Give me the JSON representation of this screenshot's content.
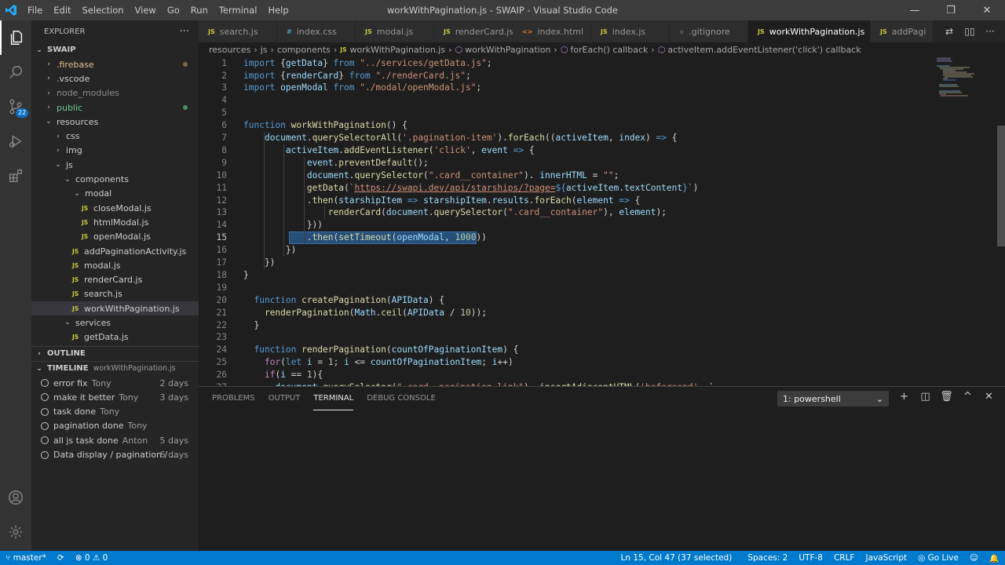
{
  "window": {
    "title": "workWithPagination.js - SWAIP - Visual Studio Code",
    "menu": [
      "File",
      "Edit",
      "Selection",
      "View",
      "Go",
      "Run",
      "Terminal",
      "Help"
    ]
  },
  "activity_bar": {
    "scm_badge": "22"
  },
  "explorer": {
    "header": "EXPLORER",
    "more": "···",
    "root": "SWAIP",
    "tree": [
      {
        "label": ".firebase",
        "chev": "›",
        "color": "#e2c08d",
        "dot": "#806a44"
      },
      {
        "label": ".vscode",
        "chev": "›",
        "color": "#cccccc"
      },
      {
        "label": "node_modules",
        "chev": "›",
        "color": "#8c8c8c"
      },
      {
        "label": "public",
        "chev": "›",
        "color": "#73c991",
        "dot": "#4b8e5e"
      },
      {
        "label": "resources",
        "chev": "⌄",
        "color": "#cccccc"
      },
      {
        "label": "css",
        "chev": "›",
        "color": "#cccccc"
      },
      {
        "label": "img",
        "chev": "›",
        "color": "#cccccc"
      },
      {
        "label": "js",
        "chev": "⌄",
        "color": "#cccccc"
      },
      {
        "label": "components",
        "chev": "⌄",
        "color": "#cccccc"
      },
      {
        "label": "modal",
        "chev": "⌄",
        "color": "#cccccc"
      },
      {
        "label": "closeModal.js",
        "js": "JS",
        "color": "#cccccc"
      },
      {
        "label": "htmlModal.js",
        "js": "JS",
        "color": "#cccccc"
      },
      {
        "label": "openModal.js",
        "js": "JS",
        "color": "#cccccc"
      },
      {
        "label": "addPaginationActivity.js",
        "js": "JS",
        "color": "#cccccc"
      },
      {
        "label": "modal.js",
        "js": "JS",
        "color": "#cccccc"
      },
      {
        "label": "renderCard.js",
        "js": "JS",
        "color": "#cccccc"
      },
      {
        "label": "search.js",
        "js": "JS",
        "color": "#cccccc"
      },
      {
        "label": "workWithPagination.js",
        "js": "JS",
        "color": "#cccccc",
        "selected": true
      },
      {
        "label": "services",
        "chev": "⌄",
        "color": "#cccccc"
      },
      {
        "label": "getData.js",
        "js": "JS",
        "color": "#cccccc"
      }
    ],
    "outline": "OUTLINE",
    "timeline": "TIMELINE",
    "timeline_file": "workWithPagination.js",
    "timeline_items": [
      {
        "msg": "error fix",
        "author": "Tony",
        "when": "2 days"
      },
      {
        "msg": "make it better",
        "author": "Tony",
        "when": "3 days"
      },
      {
        "msg": "task done",
        "author": "Tony",
        "when": ""
      },
      {
        "msg": "pagination done",
        "author": "Tony",
        "when": ""
      },
      {
        "msg": "all js task done",
        "author": "Anton",
        "when": "5 days"
      },
      {
        "msg": "Data display / pagination / ...",
        "author": "",
        "when": "6 days"
      }
    ]
  },
  "tabs": [
    {
      "label": "search.js",
      "icon": "JS",
      "icolor": "#cbcb41"
    },
    {
      "label": "index.css",
      "icon": "#",
      "icolor": "#519aba"
    },
    {
      "label": "modal.js",
      "icon": "JS",
      "icolor": "#cbcb41"
    },
    {
      "label": "renderCard.js",
      "icon": "JS",
      "icolor": "#cbcb41"
    },
    {
      "label": "index.html",
      "icon": "<>",
      "icolor": "#e37933"
    },
    {
      "label": "index.js",
      "icon": "JS",
      "icolor": "#cbcb41"
    },
    {
      "label": ".gitignore",
      "icon": "◆",
      "icolor": "#41535b"
    },
    {
      "label": "workWithPagination.js",
      "icon": "JS",
      "icolor": "#cbcb41",
      "active": true
    },
    {
      "label": "addPagi",
      "icon": "JS",
      "icolor": "#cbcb41"
    }
  ],
  "breadcrumb": [
    "resources",
    "js",
    "components",
    "workWithPagination.js",
    "workWithPagination",
    "forEach() callback",
    "activeItem.addEventListener('click') callback"
  ],
  "code": [
    [
      [
        "kw",
        "import "
      ],
      [
        "pl",
        "{"
      ],
      [
        "var",
        "getData"
      ],
      [
        "pl",
        "} "
      ],
      [
        "kw",
        "from "
      ],
      [
        "str",
        "\"../services/getData.js\""
      ],
      [
        "pl",
        ";"
      ]
    ],
    [
      [
        "kw",
        "import "
      ],
      [
        "pl",
        "{"
      ],
      [
        "var",
        "renderCard"
      ],
      [
        "pl",
        "} "
      ],
      [
        "kw",
        "from "
      ],
      [
        "str",
        "\"./renderCard.js\""
      ],
      [
        "pl",
        ";"
      ]
    ],
    [
      [
        "kw",
        "import "
      ],
      [
        "var",
        "openModal "
      ],
      [
        "kw",
        "from "
      ],
      [
        "str",
        "\"./modal/openModal.js\""
      ],
      [
        "pl",
        ";"
      ]
    ],
    [],
    [],
    [
      [
        "kw",
        "function "
      ],
      [
        "fn",
        "workWithPagination"
      ],
      [
        "pl",
        "() {"
      ]
    ],
    [
      [
        "pl",
        "    "
      ],
      [
        "var",
        "document"
      ],
      [
        "pl",
        "."
      ],
      [
        "fn",
        "querySelectorAll"
      ],
      [
        "pl",
        "("
      ],
      [
        "str",
        "'.pagination-item'"
      ],
      [
        "pl",
        ")."
      ],
      [
        "fn",
        "forEach"
      ],
      [
        "pl",
        "(("
      ],
      [
        "var",
        "activeItem"
      ],
      [
        "pl",
        ", "
      ],
      [
        "var",
        "index"
      ],
      [
        "pl",
        ") "
      ],
      [
        "kw",
        "=>"
      ],
      [
        "pl",
        " {"
      ]
    ],
    [
      [
        "pl",
        "        "
      ],
      [
        "var",
        "activeItem"
      ],
      [
        "pl",
        "."
      ],
      [
        "fn",
        "addEventListener"
      ],
      [
        "pl",
        "("
      ],
      [
        "str",
        "'click'"
      ],
      [
        "pl",
        ", "
      ],
      [
        "var",
        "event "
      ],
      [
        "kw",
        "=>"
      ],
      [
        "pl",
        " {"
      ]
    ],
    [
      [
        "pl",
        "            "
      ],
      [
        "var",
        "event"
      ],
      [
        "pl",
        "."
      ],
      [
        "fn",
        "preventDefault"
      ],
      [
        "pl",
        "();"
      ]
    ],
    [
      [
        "pl",
        "            "
      ],
      [
        "var",
        "document"
      ],
      [
        "pl",
        "."
      ],
      [
        "fn",
        "querySelector"
      ],
      [
        "pl",
        "("
      ],
      [
        "str",
        "\".card__container\""
      ],
      [
        "pl",
        "). "
      ],
      [
        "var",
        "innerHTML"
      ],
      [
        "pl",
        " = "
      ],
      [
        "str",
        "\"\""
      ],
      [
        "pl",
        ";"
      ]
    ],
    [
      [
        "pl",
        "            "
      ],
      [
        "fn",
        "getData"
      ],
      [
        "pl",
        "("
      ],
      [
        "str",
        "`"
      ],
      [
        "url",
        "https://swapi.dev/api/starships/?page="
      ],
      [
        "tpl",
        "${"
      ],
      [
        "var",
        "activeItem"
      ],
      [
        "pl",
        "."
      ],
      [
        "var",
        "textContent"
      ],
      [
        "tpl",
        "}"
      ],
      [
        "str",
        "`"
      ],
      [
        "pl",
        ")"
      ]
    ],
    [
      [
        "pl",
        "            ."
      ],
      [
        "fn",
        "then"
      ],
      [
        "pl",
        "("
      ],
      [
        "var",
        "starshipItem "
      ],
      [
        "kw",
        "=>"
      ],
      [
        "pl",
        " "
      ],
      [
        "var",
        "starshipItem"
      ],
      [
        "pl",
        "."
      ],
      [
        "var",
        "results"
      ],
      [
        "pl",
        "."
      ],
      [
        "fn",
        "forEach"
      ],
      [
        "pl",
        "("
      ],
      [
        "var",
        "element "
      ],
      [
        "kw",
        "=>"
      ],
      [
        "pl",
        " {"
      ]
    ],
    [
      [
        "pl",
        "                "
      ],
      [
        "fn",
        "renderCard"
      ],
      [
        "pl",
        "("
      ],
      [
        "var",
        "document"
      ],
      [
        "pl",
        "."
      ],
      [
        "fn",
        "querySelector"
      ],
      [
        "pl",
        "("
      ],
      [
        "str",
        "\".card__container\""
      ],
      [
        "pl",
        "), "
      ],
      [
        "var",
        "element"
      ],
      [
        "pl",
        ");"
      ]
    ],
    [
      [
        "pl",
        "            }))"
      ]
    ],
    [
      [
        "pl",
        "            ."
      ],
      [
        "fn",
        "then"
      ],
      [
        "pl",
        "("
      ],
      [
        "fn",
        "setTimeout"
      ],
      [
        "pl",
        "("
      ],
      [
        "var",
        "openModal"
      ],
      [
        "pl",
        ", "
      ],
      [
        "num",
        "1000"
      ],
      [
        "pl",
        "))"
      ]
    ],
    [
      [
        "pl",
        "        })"
      ]
    ],
    [
      [
        "pl",
        "    })"
      ]
    ],
    [
      [
        "pl",
        "}"
      ]
    ],
    [],
    [
      [
        "pl",
        "  "
      ],
      [
        "kw",
        "function "
      ],
      [
        "fn",
        "createPagination"
      ],
      [
        "pl",
        "("
      ],
      [
        "var",
        "APIData"
      ],
      [
        "pl",
        ") {"
      ]
    ],
    [
      [
        "pl",
        "    "
      ],
      [
        "fn",
        "renderPagination"
      ],
      [
        "pl",
        "("
      ],
      [
        "var",
        "Math"
      ],
      [
        "pl",
        "."
      ],
      [
        "fn",
        "ceil"
      ],
      [
        "pl",
        "("
      ],
      [
        "var",
        "APIData"
      ],
      [
        "pl",
        " / "
      ],
      [
        "num",
        "10"
      ],
      [
        "pl",
        "));"
      ]
    ],
    [
      [
        "pl",
        "  }"
      ]
    ],
    [],
    [
      [
        "pl",
        "  "
      ],
      [
        "kw",
        "function "
      ],
      [
        "fn",
        "renderPagination"
      ],
      [
        "pl",
        "("
      ],
      [
        "var",
        "countOfPaginationItem"
      ],
      [
        "pl",
        ") {"
      ]
    ],
    [
      [
        "pl",
        "    "
      ],
      [
        "ctl",
        "for"
      ],
      [
        "pl",
        "("
      ],
      [
        "kw",
        "let "
      ],
      [
        "var",
        "i"
      ],
      [
        "pl",
        " = "
      ],
      [
        "num",
        "1"
      ],
      [
        "pl",
        "; "
      ],
      [
        "var",
        "i"
      ],
      [
        "pl",
        " <= "
      ],
      [
        "var",
        "countOfPaginationItem"
      ],
      [
        "pl",
        "; "
      ],
      [
        "var",
        "i"
      ],
      [
        "pl",
        "++)"
      ]
    ],
    [
      [
        "pl",
        "    "
      ],
      [
        "ctl",
        "if"
      ],
      [
        "pl",
        "("
      ],
      [
        "var",
        "i"
      ],
      [
        "pl",
        " == "
      ],
      [
        "num",
        "1"
      ],
      [
        "pl",
        "){"
      ]
    ],
    [
      [
        "pl",
        "      "
      ],
      [
        "var",
        "document"
      ],
      [
        "pl",
        "."
      ],
      [
        "fn",
        "querySelector"
      ],
      [
        "pl",
        "("
      ],
      [
        "str",
        "\".card__pagination-link\""
      ],
      [
        "pl",
        "). "
      ],
      [
        "fn",
        "insertAdjacentHTML"
      ],
      [
        "pl",
        "("
      ],
      [
        "str",
        "'beforeend'"
      ],
      [
        "pl",
        ", `"
      ]
    ]
  ],
  "panel": {
    "tabs": [
      "PROBLEMS",
      "OUTPUT",
      "TERMINAL",
      "DEBUG CONSOLE"
    ],
    "active_tab": "TERMINAL",
    "terminal_select": "1: powershell"
  },
  "statusbar": {
    "branch": "master*",
    "errors": "0",
    "warnings": "0",
    "position": "Ln 15, Col 47 (37 selected)",
    "spaces": "Spaces: 2",
    "encoding": "UTF-8",
    "eol": "CRLF",
    "language": "JavaScript",
    "golive": "Go Live"
  },
  "colors": {
    "accent": "#007acc",
    "selection": "#264f78"
  }
}
